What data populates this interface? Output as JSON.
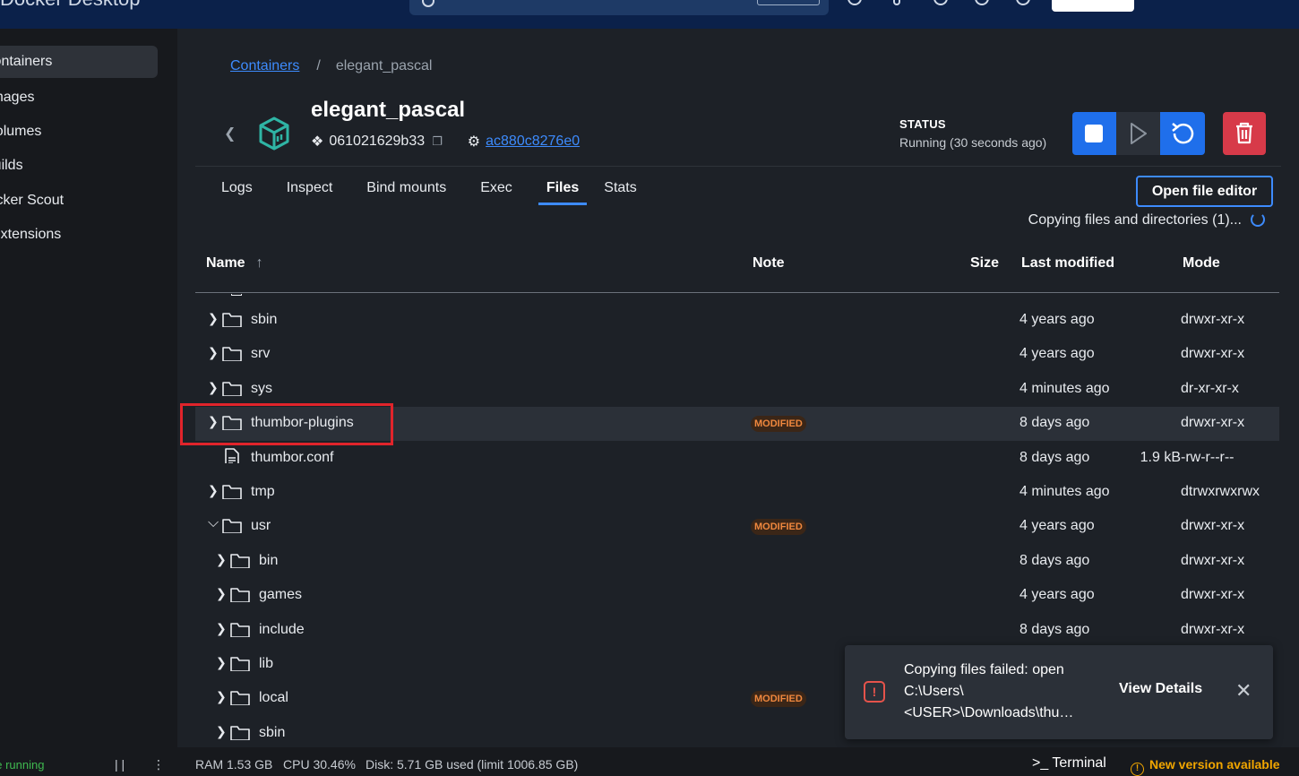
{
  "topbar": {
    "brand": "Docker Desktop"
  },
  "sidebar": {
    "items": [
      {
        "label": "Containers",
        "active": true
      },
      {
        "label": "Images"
      },
      {
        "label": "Volumes"
      },
      {
        "label": "Builds"
      },
      {
        "label": "Docker Scout"
      },
      {
        "label": "Extensions"
      }
    ]
  },
  "breadcrumb": {
    "root": "Containers",
    "sep": "/",
    "current": "elegant_pascal"
  },
  "container": {
    "name": "elegant_pascal",
    "image_id": "061021629b33",
    "container_id": "ac880c8276e0",
    "status_label": "STATUS",
    "status_value": "Running (30 seconds ago)"
  },
  "tabs": [
    "Logs",
    "Inspect",
    "Bind mounts",
    "Exec",
    "Files",
    "Stats"
  ],
  "active_tab": "Files",
  "files": {
    "open_editor_label": "Open file editor",
    "copying_text": "Copying files and directories (1)...",
    "columns": {
      "name": "Name",
      "note": "Note",
      "size": "Size",
      "modified": "Last modified",
      "mode": "Mode"
    },
    "rows": [
      {
        "name": "sbin",
        "type": "folder",
        "depth": 0,
        "chevron": "right",
        "note": "",
        "size": "",
        "modified": "4 years ago",
        "mode": "drwxr-xr-x"
      },
      {
        "name": "srv",
        "type": "folder",
        "depth": 0,
        "chevron": "right",
        "note": "",
        "size": "",
        "modified": "4 years ago",
        "mode": "drwxr-xr-x"
      },
      {
        "name": "sys",
        "type": "folder",
        "depth": 0,
        "chevron": "right",
        "note": "",
        "size": "",
        "modified": "4 minutes ago",
        "mode": "dr-xr-xr-x"
      },
      {
        "name": "thumbor-plugins",
        "type": "folder",
        "depth": 0,
        "chevron": "right",
        "note": "MODIFIED",
        "size": "",
        "modified": "8 days ago",
        "mode": "drwxr-xr-x",
        "highlight": true
      },
      {
        "name": "thumbor.conf",
        "type": "file",
        "depth": 0,
        "chevron": "",
        "note": "",
        "size": "1.9 kB",
        "modified": "8 days ago",
        "mode": "-rw-r--r--"
      },
      {
        "name": "tmp",
        "type": "folder",
        "depth": 0,
        "chevron": "right",
        "note": "",
        "size": "",
        "modified": "4 minutes ago",
        "mode": "dtrwxrwxrwx"
      },
      {
        "name": "usr",
        "type": "folder",
        "depth": 0,
        "chevron": "down",
        "note": "MODIFIED",
        "size": "",
        "modified": "4 years ago",
        "mode": "drwxr-xr-x"
      },
      {
        "name": "bin",
        "type": "folder",
        "depth": 1,
        "chevron": "right",
        "note": "",
        "size": "",
        "modified": "8 days ago",
        "mode": "drwxr-xr-x"
      },
      {
        "name": "games",
        "type": "folder",
        "depth": 1,
        "chevron": "right",
        "note": "",
        "size": "",
        "modified": "4 years ago",
        "mode": "drwxr-xr-x"
      },
      {
        "name": "include",
        "type": "folder",
        "depth": 1,
        "chevron": "right",
        "note": "",
        "size": "",
        "modified": "8 days ago",
        "mode": "drwxr-xr-x"
      },
      {
        "name": "lib",
        "type": "folder",
        "depth": 1,
        "chevron": "right",
        "note": "",
        "size": "",
        "modified": "",
        "mode": ""
      },
      {
        "name": "local",
        "type": "folder",
        "depth": 1,
        "chevron": "right",
        "note": "MODIFIED",
        "size": "",
        "modified": "",
        "mode": ""
      },
      {
        "name": "sbin",
        "type": "folder",
        "depth": 1,
        "chevron": "right",
        "note": "",
        "size": "",
        "modified": "",
        "mode": ""
      }
    ]
  },
  "toast": {
    "message": "Copying files failed: open C:\\Users\\<USER>\\Downloads\\thu…",
    "action": "View Details"
  },
  "statusbar": {
    "engine": "Engine running",
    "ram": "RAM 1.53 GB",
    "cpu": "CPU 30.46%",
    "disk": "Disk: 5.71 GB used (limit 1006.85 GB)",
    "terminal": ">_ Terminal",
    "update": "New version available"
  },
  "colors": {
    "accent": "#3d8bfd",
    "danger": "#d73a49",
    "warning": "#f0a500",
    "badge": "#f0883e"
  }
}
